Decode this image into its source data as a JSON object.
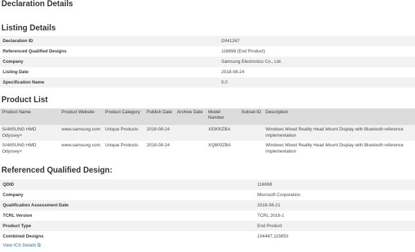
{
  "page_title": "Declaration Details",
  "listing": {
    "heading": "Listing Details",
    "rows": [
      {
        "label": "Declaration ID",
        "value": "D041267"
      },
      {
        "label": "Referenced Qualified Designs",
        "value": "116698 (End Product)"
      },
      {
        "label": "Company",
        "value": "Samsung Electronics Co., Ltd."
      },
      {
        "label": "Listing Date",
        "value": "2018-08-24"
      },
      {
        "label": "Specification Name",
        "value": "5.0"
      }
    ]
  },
  "product_list": {
    "heading": "Product List",
    "columns": [
      "Product Name",
      "Product Website",
      "Product Category",
      "Publish Date",
      "Archive Date",
      "Model Number",
      "Subset ID",
      "Description"
    ],
    "rows": [
      [
        "SAMSUNG HMD Odyssey+",
        "www.samsung.com",
        "Unique Products",
        "2018-08-24",
        "",
        "XE800ZBA",
        "",
        "Windows Mixed Reality Head Mount Display with Bluetooth reference implementation"
      ],
      [
        "SAMSUNG HMD Odyssey+",
        "www.samsung.com",
        "Unique Products",
        "2018-08-24",
        "",
        "XQ800ZBA",
        "",
        "Windows Mixed Reality Head Mount Display with Bluetooth reference implementation"
      ]
    ]
  },
  "rqd": {
    "heading": "Referenced Qualified Design:",
    "rows": [
      {
        "label": "QDID",
        "value": "116698"
      },
      {
        "label": "Company",
        "value": "Microsoft Corporation"
      },
      {
        "label": "Qualification Assessment Date",
        "value": "2018-08-21"
      },
      {
        "label": "TCRL Version",
        "value": "TCRL 2018-1"
      },
      {
        "label": "Product Type",
        "value": "End Product"
      },
      {
        "label": "Combined Designs",
        "value": "104467,115853"
      }
    ]
  },
  "ics_link": "View ICS Details ⧉"
}
